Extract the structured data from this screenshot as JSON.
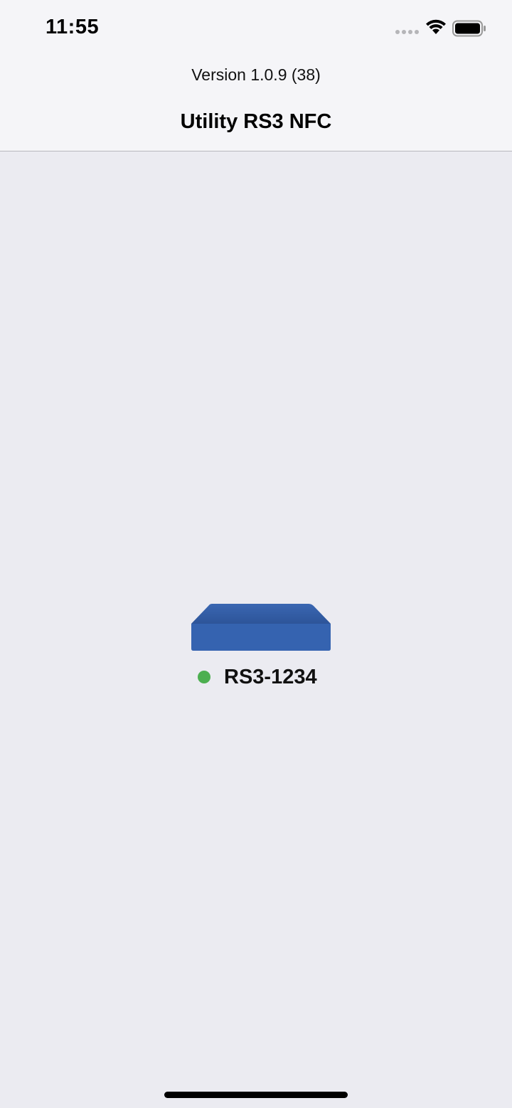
{
  "status_bar": {
    "time": "11:55",
    "icons": [
      "cellular-signal-icon",
      "wifi-icon",
      "battery-icon"
    ]
  },
  "header": {
    "version": "Version 1.0.9 (38)",
    "title": "Utility RS3 NFC"
  },
  "device": {
    "icon": "router-device-icon",
    "name": "RS3-1234",
    "status": "online",
    "status_color": "#4caf50",
    "color": "#3563b0"
  },
  "colors": {
    "background": "#ebebf1",
    "header_background": "#f5f5f8"
  }
}
